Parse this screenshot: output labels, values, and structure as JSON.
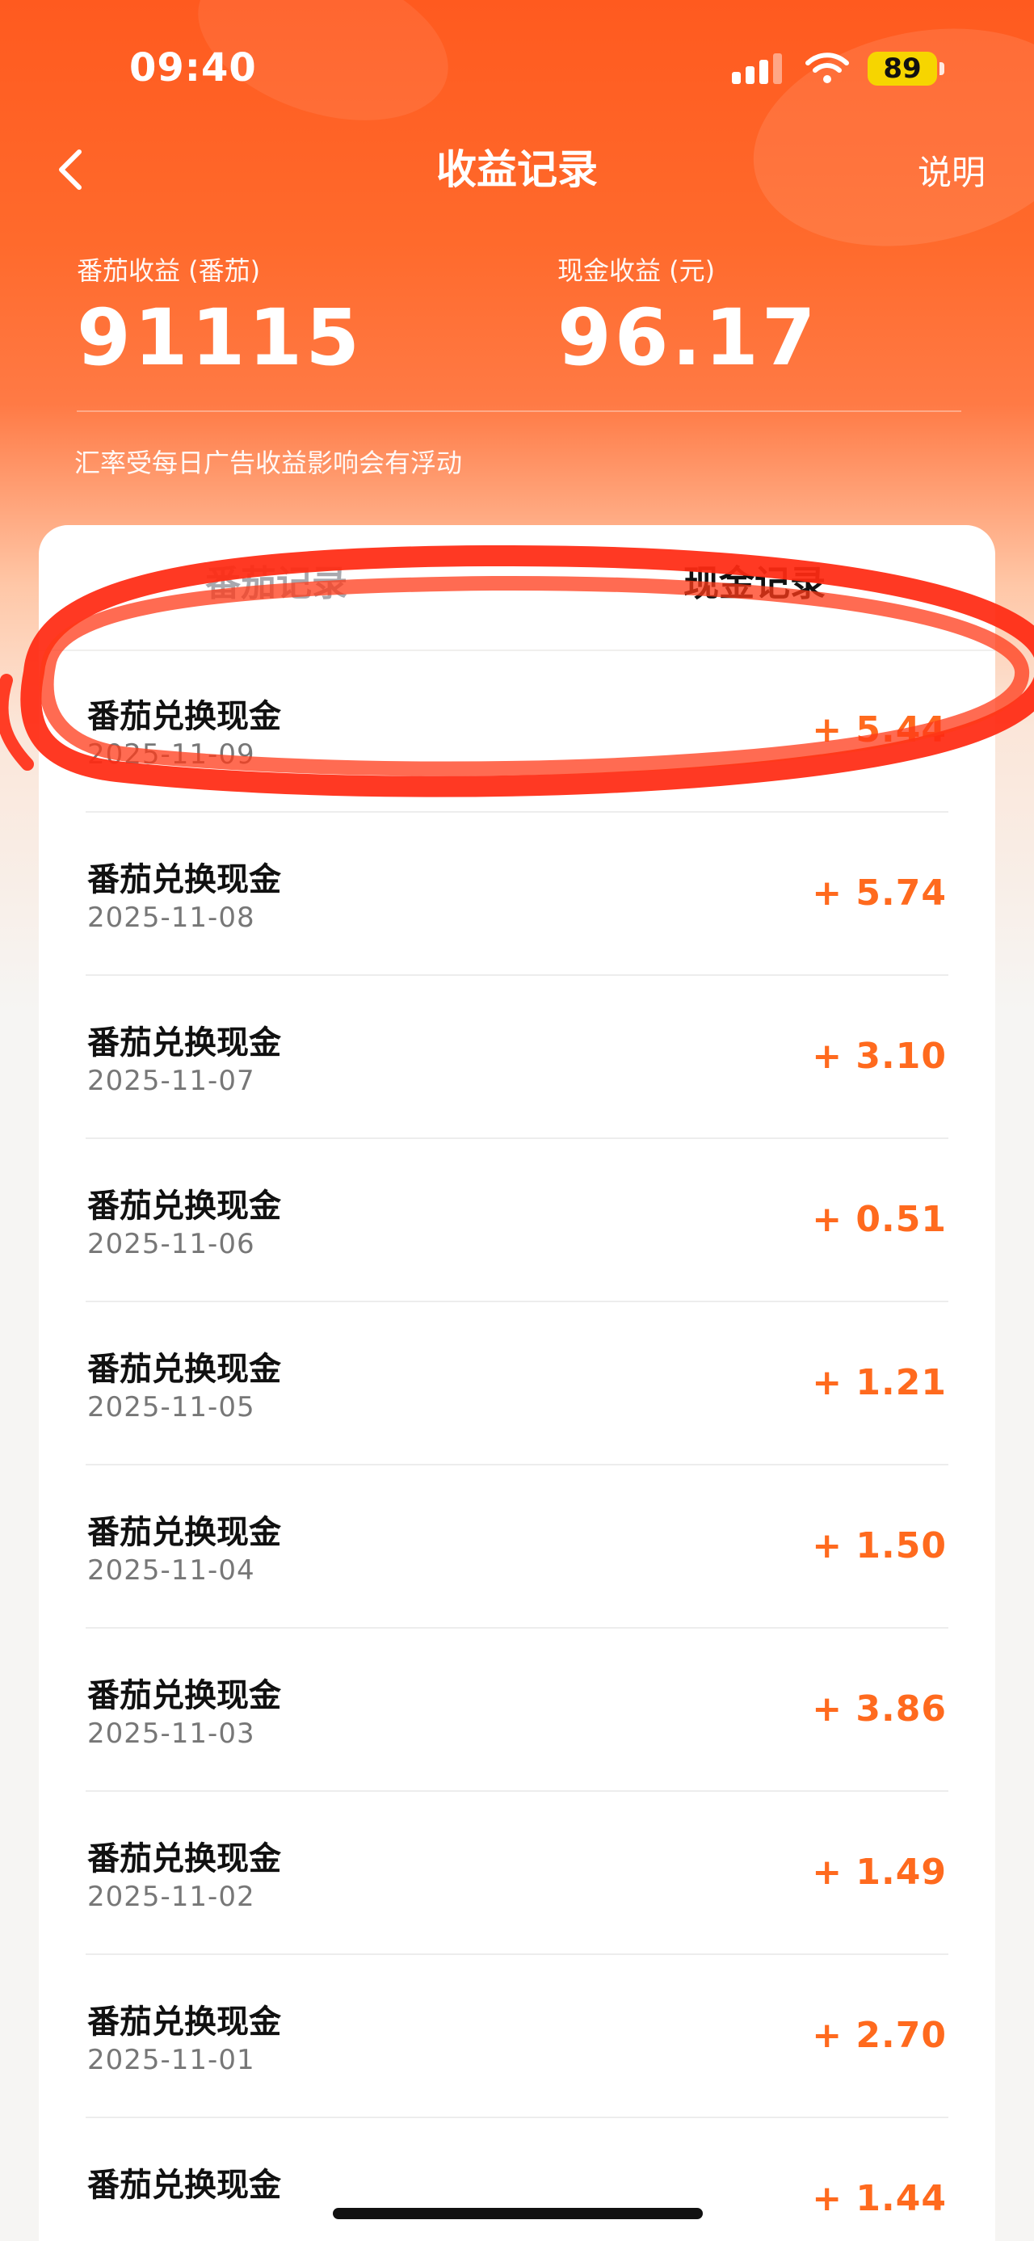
{
  "status_bar": {
    "time": "09:40",
    "battery": "89"
  },
  "nav": {
    "title": "收益记录",
    "help": "说明"
  },
  "summary": {
    "tomato_label": "番茄收益 (番茄)",
    "tomato_value": "91115",
    "cash_label": "现金收益 (元)",
    "cash_value": "96.17",
    "note": "汇率受每日广告收益影响会有浮动"
  },
  "tabs": {
    "tomato": "番茄记录",
    "cash": "现金记录",
    "selected": "cash"
  },
  "records": [
    {
      "title": "番茄兑换现金",
      "date": "2025-11-09",
      "amount": "+ 5.44"
    },
    {
      "title": "番茄兑换现金",
      "date": "2025-11-08",
      "amount": "+ 5.74"
    },
    {
      "title": "番茄兑换现金",
      "date": "2025-11-07",
      "amount": "+ 3.10"
    },
    {
      "title": "番茄兑换现金",
      "date": "2025-11-06",
      "amount": "+ 0.51"
    },
    {
      "title": "番茄兑换现金",
      "date": "2025-11-05",
      "amount": "+ 1.21"
    },
    {
      "title": "番茄兑换现金",
      "date": "2025-11-04",
      "amount": "+ 1.50"
    },
    {
      "title": "番茄兑换现金",
      "date": "2025-11-03",
      "amount": "+ 3.86"
    },
    {
      "title": "番茄兑换现金",
      "date": "2025-11-02",
      "amount": "+ 1.49"
    },
    {
      "title": "番茄兑换现金",
      "date": "2025-11-01",
      "amount": "+ 2.70"
    },
    {
      "title": "番茄兑换现金",
      "date": "",
      "amount": "+ 1.44"
    }
  ],
  "colors": {
    "header": "#ff5a1f",
    "accent": "#ff6a1e",
    "highlight": "#ff2a12"
  },
  "icons": {
    "back": "chevron-left-icon",
    "signal": "signal-icon",
    "wifi": "wifi-icon",
    "battery": "battery-icon"
  }
}
